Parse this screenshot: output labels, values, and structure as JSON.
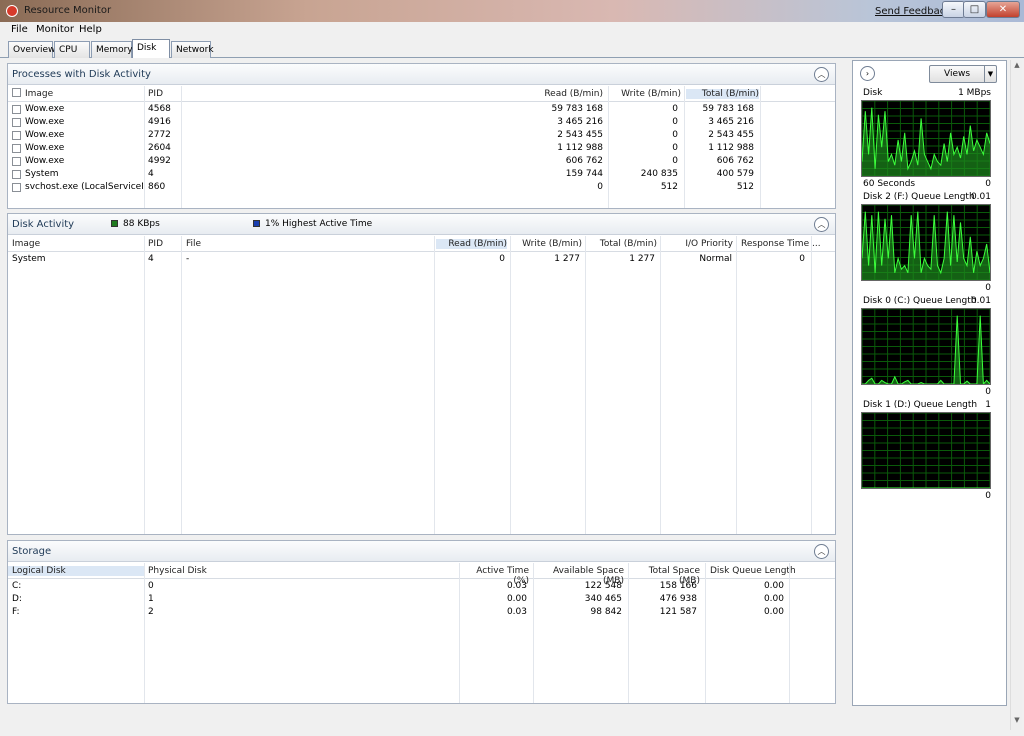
{
  "window": {
    "title": "Resource Monitor",
    "send_feedback": "Send Feedback",
    "min": "–",
    "max": "□",
    "close": "✕"
  },
  "menu": [
    "File",
    "Monitor",
    "Help"
  ],
  "tabs": [
    "Overview",
    "CPU",
    "Memory",
    "Disk",
    "Network"
  ],
  "active_tab": "Disk",
  "processes": {
    "title": "Processes with Disk Activity",
    "columns": [
      "Image",
      "PID",
      "Read (B/min)",
      "Write (B/min)",
      "Total (B/min)"
    ],
    "rows": [
      [
        "Wow.exe",
        "4568",
        "59 783 168",
        "0",
        "59 783 168"
      ],
      [
        "Wow.exe",
        "4916",
        "3 465 216",
        "0",
        "3 465 216"
      ],
      [
        "Wow.exe",
        "2772",
        "2 543 455",
        "0",
        "2 543 455"
      ],
      [
        "Wow.exe",
        "2604",
        "1 112 988",
        "0",
        "1 112 988"
      ],
      [
        "Wow.exe",
        "4992",
        "606 762",
        "0",
        "606 762"
      ],
      [
        "System",
        "4",
        "159 744",
        "240 835",
        "400 579"
      ],
      [
        "svchost.exe (LocalServiceNet...",
        "860",
        "0",
        "512",
        "512"
      ]
    ]
  },
  "disk_activity": {
    "title": "Disk Activity",
    "legend1": "88 KBps",
    "legend2": "1% Highest Active Time",
    "legend1_color": "#1f7a1f",
    "legend2_color": "#1a3fb0",
    "columns": [
      "Image",
      "PID",
      "File",
      "Read (B/min)",
      "Write (B/min)",
      "Total (B/min)",
      "I/O Priority",
      "Response Time ..."
    ],
    "rows": [
      [
        "System",
        "4",
        "-",
        "0",
        "1 277",
        "1 277",
        "Normal",
        "0"
      ]
    ]
  },
  "storage": {
    "title": "Storage",
    "columns": [
      "Logical Disk",
      "Physical Disk",
      "Active Time (%)",
      "Available Space (MB)",
      "Total Space (MB)",
      "Disk Queue Length"
    ],
    "rows": [
      [
        "C:",
        "0",
        "0.03",
        "122 548",
        "158 166",
        "0.00"
      ],
      [
        "D:",
        "1",
        "0.00",
        "340 465",
        "476 938",
        "0.00"
      ],
      [
        "F:",
        "2",
        "0.03",
        "98 842",
        "121 587",
        "0.00"
      ]
    ]
  },
  "right_pane": {
    "views_label": "Views",
    "graphs": [
      {
        "title": "Disk",
        "scale": "1 MBps",
        "bottom_left": "60 Seconds",
        "bottom_right": "0",
        "series": [
          0.2,
          0.9,
          0.3,
          0.95,
          0.1,
          0.85,
          0.4,
          0.9,
          0.2,
          0.3,
          0.15,
          0.5,
          0.2,
          0.6,
          0.1,
          0.2,
          0.35,
          0.15,
          0.8,
          0.3,
          0.2,
          0.1,
          0.3,
          0.2,
          0.15,
          0.45,
          0.2,
          0.6,
          0.3,
          0.4,
          0.25,
          0.55,
          0.3,
          0.7,
          0.35,
          0.5,
          0.4,
          0.3,
          0.6,
          0.45
        ]
      },
      {
        "title": "Disk 2 (F:) Queue Length",
        "scale": "0.01",
        "bottom_left": "",
        "bottom_right": "0",
        "series": [
          0.3,
          0.95,
          0.2,
          0.9,
          0.1,
          0.95,
          0.2,
          0.85,
          0.3,
          0.9,
          0.1,
          0.3,
          0.15,
          0.2,
          0.1,
          0.9,
          0.3,
          0.95,
          0.1,
          0.3,
          0.2,
          0.15,
          0.9,
          0.2,
          0.1,
          0.3,
          0.95,
          0.2,
          0.9,
          0.25,
          0.8,
          0.3,
          0.2,
          0.6,
          0.1,
          0.4,
          0.2,
          0.3,
          0.5,
          0.1
        ]
      },
      {
        "title": "Disk 0 (C:) Queue Length",
        "scale": "0.01",
        "bottom_left": "",
        "bottom_right": "0",
        "series": [
          0,
          0,
          0.05,
          0.08,
          0,
          0,
          0.05,
          0.02,
          0,
          0,
          0.1,
          0,
          0,
          0.03,
          0.05,
          0,
          0,
          0,
          0.02,
          0,
          0,
          0,
          0,
          0,
          0.05,
          0,
          0,
          0,
          0,
          0.95,
          0,
          0,
          0.04,
          0,
          0,
          0,
          0.95,
          0,
          0.05,
          0
        ]
      },
      {
        "title": "Disk 1 (D:) Queue Length",
        "scale": "1",
        "bottom_left": "",
        "bottom_right": "0",
        "series": [
          0,
          0,
          0,
          0,
          0,
          0,
          0,
          0,
          0,
          0,
          0,
          0,
          0,
          0,
          0,
          0,
          0,
          0,
          0,
          0,
          0,
          0,
          0,
          0,
          0,
          0,
          0,
          0,
          0,
          0,
          0,
          0,
          0,
          0,
          0,
          0,
          0,
          0,
          0,
          0
        ]
      }
    ]
  }
}
